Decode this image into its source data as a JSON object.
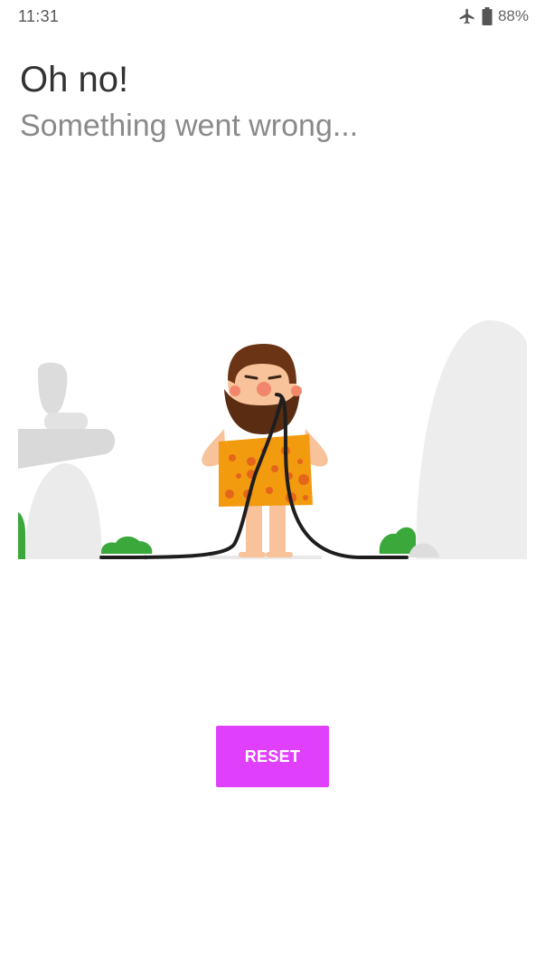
{
  "status_bar": {
    "time": "11:31",
    "battery_percent": "88%",
    "icons": [
      "airplane-mode-icon",
      "battery-icon"
    ]
  },
  "error": {
    "title": "Oh no!",
    "subtitle": "Something went wrong..."
  },
  "illustration": {
    "description_icon": "caveman-chewing-cable-illustration"
  },
  "actions": {
    "reset_label": "RESET"
  },
  "colors": {
    "accent": "#e040fb",
    "title": "#333333",
    "subtitle": "#8a8a8a",
    "tunic": "#f5a623",
    "beard": "#5a2d12",
    "bush": "#3aa83a",
    "rock": "#ededed"
  }
}
